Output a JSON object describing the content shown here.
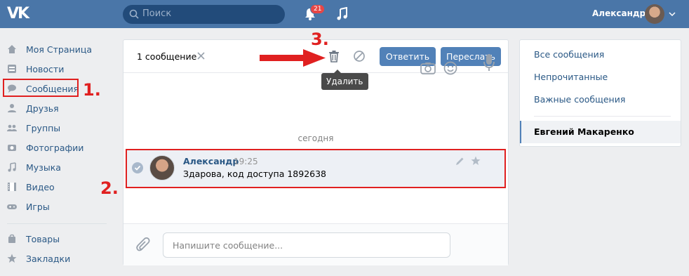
{
  "header": {
    "logo": "VK",
    "search_placeholder": "Поиск",
    "notifications_count": "21",
    "user_name": "Александр"
  },
  "nav": {
    "items": [
      {
        "label": "Моя Страница",
        "icon": "home-icon"
      },
      {
        "label": "Новости",
        "icon": "news-icon"
      },
      {
        "label": "Сообщения",
        "icon": "messages-icon"
      },
      {
        "label": "Друзья",
        "icon": "friends-icon"
      },
      {
        "label": "Группы",
        "icon": "groups-icon"
      },
      {
        "label": "Фотографии",
        "icon": "camera-icon"
      },
      {
        "label": "Музыка",
        "icon": "music-icon"
      },
      {
        "label": "Видео",
        "icon": "video-icon"
      },
      {
        "label": "Игры",
        "icon": "games-icon"
      },
      {
        "label": "Товары",
        "icon": "bag-icon"
      },
      {
        "label": "Закладки",
        "icon": "star-icon"
      }
    ]
  },
  "main": {
    "selected_count": "1 сообщение",
    "reply_label": "Ответить",
    "forward_label": "Переслать",
    "tooltip": "Удалить",
    "date_separator": "сегодня",
    "message": {
      "author": "Александр",
      "time": "19:25",
      "text": "Здарова, код доступа 1892638"
    },
    "input_placeholder": "Напишите сообщение..."
  },
  "right": {
    "items": [
      "Все сообщения",
      "Непрочитанные",
      "Важные сообщения"
    ],
    "active": "Евгений Макаренко"
  },
  "annotations": {
    "step1": "1.",
    "step2": "2.",
    "step3": "3."
  },
  "colors": {
    "brand": "#4a76a8",
    "button": "#5181b8",
    "link": "#2a5885",
    "annotation": "#e02020"
  }
}
